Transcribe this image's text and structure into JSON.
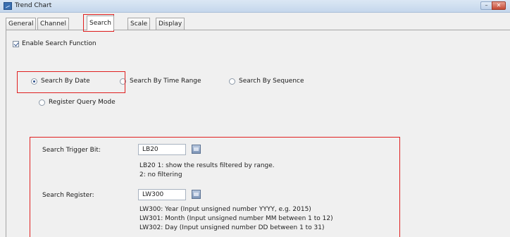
{
  "window": {
    "title": "Trend Chart",
    "minimize_glyph": "–",
    "close_glyph": "✕",
    "accent_close": "#c44a34"
  },
  "tabs": [
    {
      "label": "General"
    },
    {
      "label": "Channel"
    },
    {
      "label": "Search"
    },
    {
      "label": "Scale"
    },
    {
      "label": "Display"
    }
  ],
  "active_tab": "Search",
  "search": {
    "enable_label": "Enable Search Function",
    "enable_checked": true,
    "modes": {
      "by_date": "Search By Date",
      "by_time_range": "Search By Time Range",
      "by_sequence": "Search By Sequence",
      "register_query": "Register Query Mode"
    },
    "selected_mode": "Search By Date",
    "trigger_bit": {
      "label": "Search Trigger Bit:",
      "value": "LB20",
      "desc_line1": "LB20 1: show the results filtered by range.",
      "desc_line2": "2: no filtering"
    },
    "register": {
      "label": "Search Register:",
      "value": "LW300",
      "desc_line1": "LW300: Year (Input unsigned number YYYY, e.g. 2015)",
      "desc_line2": "LW301: Month (Input unsigned number MM between 1 to 12)",
      "desc_line3": "LW302: Day (Input unsigned number DD between 1 to 31)"
    }
  },
  "highlight_color": "#e02020"
}
